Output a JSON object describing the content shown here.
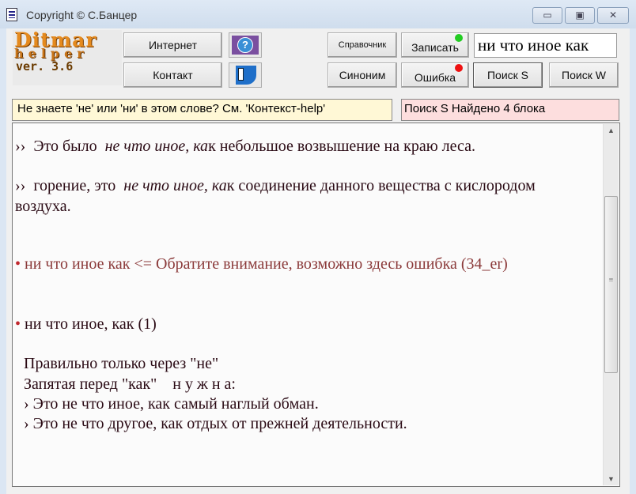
{
  "window": {
    "title": "Copyright © С.Банцер",
    "minimize": "▭",
    "maximize": "▣",
    "close": "✕"
  },
  "logo": {
    "line1": "Ditmar",
    "line2": "helper",
    "line3": "ver. 3.6"
  },
  "toolbar": {
    "internet": "Интернет",
    "contact": "Контакт",
    "reference": "Справочник",
    "synonym": "Синоним",
    "record": "Записать",
    "error": "Ошибка",
    "search_s": "Поиск S",
    "search_w": "Поиск W",
    "record_indicator_color": "#22cc22",
    "error_indicator_color": "#ee1111"
  },
  "search": {
    "value": "ни что иное как"
  },
  "hint": "Не знаете 'не' или 'ни' в этом слове? См. 'Контекст-help'",
  "status": "Поиск S Найдено  4 блока",
  "content": {
    "ex1": {
      "mark": "››",
      "pre": "Это было ",
      "it": "не что иное, ка",
      "post": "к небольшое возвышение на краю леса."
    },
    "ex2": {
      "mark": "››",
      "pre": "горение, это ",
      "it": "не что иное, ка",
      "post": "к соединение данного вещества с кислородом",
      "cont": "воздуха."
    },
    "warn": {
      "bullet": "•",
      "text": "ни что иное как   <= Обратите внимание, возможно здесь ошибка  (34_er)"
    },
    "entry": {
      "bullet": "•",
      "text": "ни что иное, как (1)"
    },
    "rule1": "Правильно только через \"не\"",
    "rule2": "Запятая перед \"как\"    н у ж н а:",
    "rule3": "› Это не что иное, как самый наглый обман.",
    "rule4": "› Это не что другое, как отдых от прежней деятельности."
  }
}
